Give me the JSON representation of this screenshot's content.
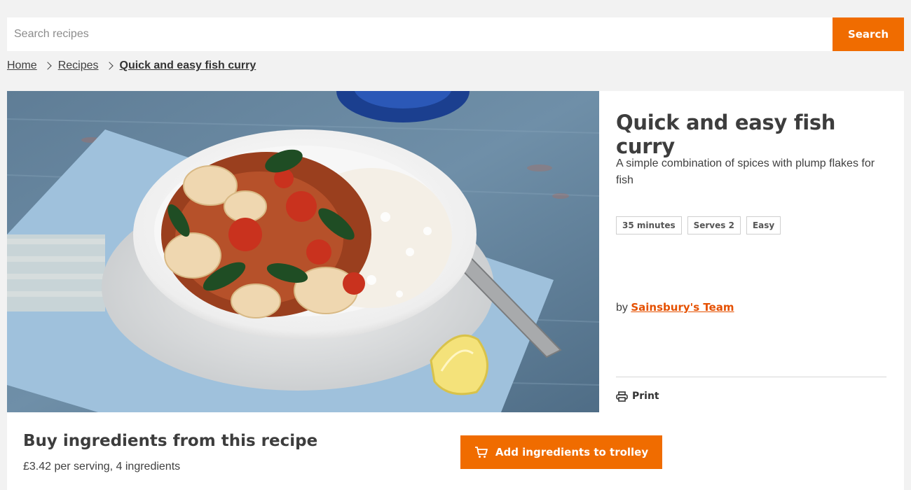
{
  "search": {
    "placeholder": "Search recipes",
    "value": "",
    "button_label": "Search"
  },
  "breadcrumb": {
    "items": [
      "Home",
      "Recipes",
      "Quick and easy fish curry"
    ]
  },
  "recipe": {
    "title": "Quick and easy fish curry",
    "description": "A simple combination of spices with plump flakes for fish",
    "tags": [
      "35 minutes",
      "Serves 2",
      "Easy"
    ],
    "author_prefix": "by",
    "author_name": "Sainsbury's Team",
    "print_label": "Print",
    "image_icon": "fish-curry-photo"
  },
  "buy": {
    "title": "Buy ingredients from this recipe",
    "subtitle": "£3.42 per serving, 4 ingredients",
    "button_label": "Add ingredients to trolley",
    "button_icon": "cart-icon"
  },
  "colors": {
    "accent": "#f06c00",
    "link": "#e55000",
    "page_bg": "#f2f2f2"
  }
}
